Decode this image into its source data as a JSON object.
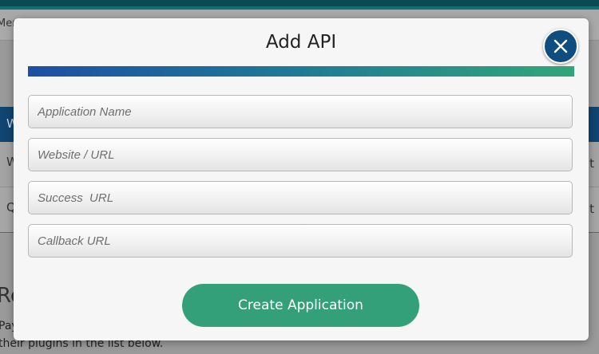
{
  "background": {
    "menu_text": "Men",
    "bar_text": "W",
    "row1_left": "W",
    "row1_right": "t",
    "row2_left": "Q",
    "row2_right": "t",
    "heading": "Re",
    "para_line1": "Pay",
    "para_line2": "their plugins in the list below."
  },
  "modal": {
    "title": "Add API",
    "fields": {
      "application_name": {
        "placeholder": "Application Name",
        "value": ""
      },
      "website_url": {
        "placeholder": "Website / URL",
        "value": ""
      },
      "success_url": {
        "placeholder": "Success  URL",
        "value": ""
      },
      "callback_url": {
        "placeholder": "Callback URL",
        "value": ""
      }
    },
    "create_label": "Create Application",
    "close_icon": "close-icon"
  },
  "colors": {
    "accent_blue": "#0f4d80",
    "button_green": "#33a07a",
    "gradient_start": "#1d4fa3",
    "gradient_end": "#33a57a"
  }
}
